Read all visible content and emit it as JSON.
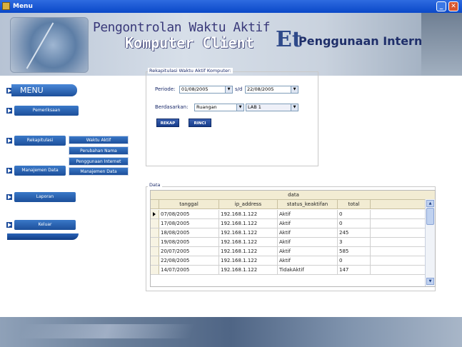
{
  "window": {
    "title": "Menu"
  },
  "header": {
    "line1": "Pengontrolan Waktu Aktif",
    "line2": "Komputer Client",
    "logo": "Et",
    "line3": "Penggunaan Internet"
  },
  "menu": {
    "title": "MENU",
    "items": [
      {
        "label": "Pemeriksaan"
      },
      {
        "label": "Rekapitulasi"
      },
      {
        "label": "Manajemen Data"
      },
      {
        "label": "Laporan"
      },
      {
        "label": "Keluar"
      }
    ],
    "submenu": [
      {
        "label": "Waktu Aktif"
      },
      {
        "label": "Perubahan Nama"
      },
      {
        "label": "Penggunaan Internet"
      },
      {
        "label": "Manajemen Data"
      }
    ]
  },
  "form": {
    "legend": "Rekapitulasi Waktu Aktif Komputer:",
    "periode_label": "Periode:",
    "date_from": "01/08/2005",
    "sd_label": "s/d",
    "date_to": "22/08/2005",
    "berdasarkan_label": "Berdasarkan:",
    "berdasarkan_value": "Ruangan",
    "lab_value": "LAB 1",
    "rekap_button": "REKAP",
    "rinci_button": "RINCI"
  },
  "data_panel": {
    "legend": "Data",
    "caption": "data",
    "columns": [
      "tanggal",
      "ip_address",
      "status_keaktifan",
      "total"
    ],
    "rows": [
      [
        "07/08/2005",
        "192.168.1.122",
        "Aktif",
        "0"
      ],
      [
        "17/08/2005",
        "192.168.1.122",
        "Aktif",
        "0"
      ],
      [
        "18/08/2005",
        "192.168.1.122",
        "Aktif",
        "245"
      ],
      [
        "19/08/2005",
        "192.168.1.122",
        "Aktif",
        "3"
      ],
      [
        "20/07/2005",
        "192.168.1.122",
        "Aktif",
        "585"
      ],
      [
        "22/08/2005",
        "192.168.1.122",
        "Aktif",
        "0"
      ],
      [
        "14/07/2005",
        "192.168.1.122",
        "TidakAktif",
        "147"
      ]
    ]
  },
  "icons": {
    "app": "app-icon",
    "minimize": "minimize-icon",
    "close": "close-icon",
    "menu_arrow": "arrow-icon",
    "dropdown": "chevron-down-icon",
    "row_pointer": "row-pointer-icon",
    "scroll_up": "scroll-up-icon",
    "scroll_down": "scroll-down-icon"
  }
}
